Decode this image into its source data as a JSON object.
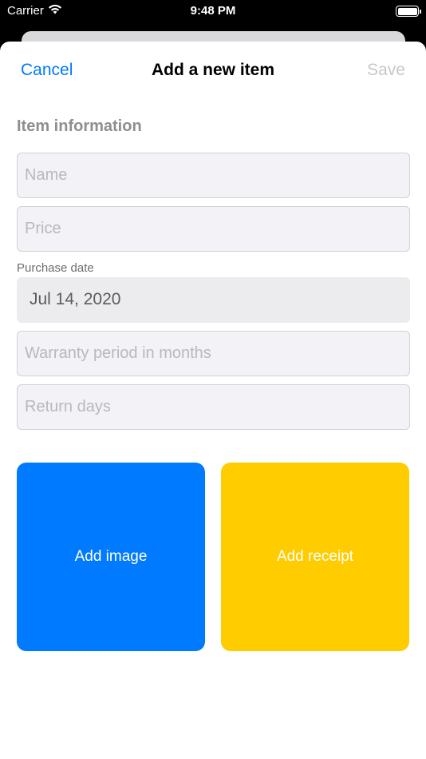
{
  "status_bar": {
    "carrier": "Carrier",
    "time": "9:48 PM",
    "wifi_icon": "wifi-icon",
    "battery_icon": "battery-icon"
  },
  "nav": {
    "cancel_label": "Cancel",
    "title": "Add a new item",
    "save_label": "Save"
  },
  "form": {
    "section_title": "Item information",
    "name_placeholder": "Name",
    "price_placeholder": "Price",
    "purchase_date_label": "Purchase date",
    "purchase_date_value": "Jul 14, 2020",
    "warranty_placeholder": "Warranty period in months",
    "return_days_placeholder": "Return days"
  },
  "tiles": {
    "add_image_label": "Add image",
    "add_receipt_label": "Add receipt"
  },
  "colors": {
    "accent": "#007aff",
    "add_image_bg": "#007aff",
    "add_receipt_bg": "#ffcc00",
    "save_disabled": "#c7c7cc"
  }
}
